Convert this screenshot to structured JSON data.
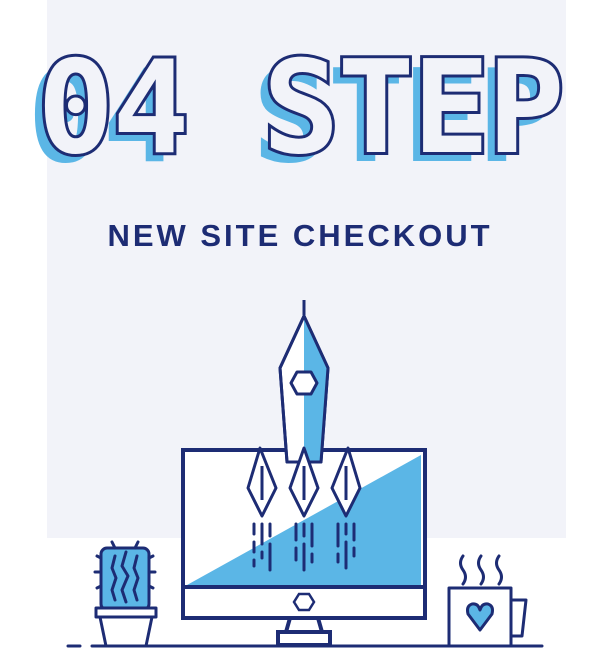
{
  "headline": {
    "title": "04 STEP",
    "subtitle": "NEW SITE CHECKOUT"
  },
  "colors": {
    "navy": "#1d2c74",
    "sky_blue": "#5bb6e6",
    "panel_bg": "#f2f3f9",
    "white": "#ffffff"
  },
  "illustration": {
    "icons": [
      "rocket-icon",
      "computer-monitor-icon",
      "cactus-icon",
      "coffee-mug-icon",
      "heart-icon",
      "steam-icon"
    ]
  }
}
